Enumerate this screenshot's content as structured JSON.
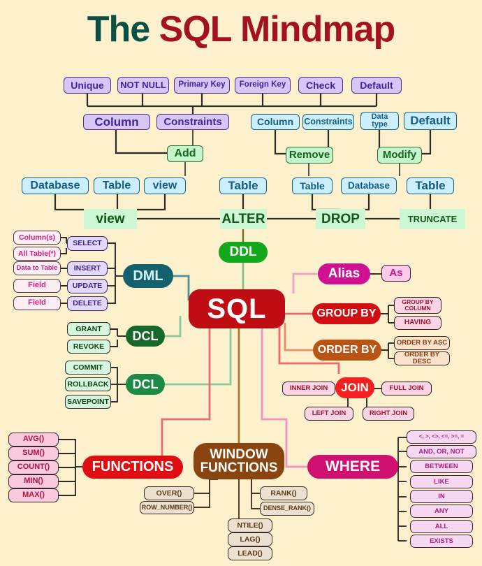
{
  "title": {
    "part1": "The ",
    "part2": "SQL Mindmap"
  },
  "background_color": "#fdf0cd",
  "center": {
    "label": "SQL",
    "color": "#c00d13"
  },
  "branches": {
    "ddl": {
      "label": "DDL",
      "color": "#12a81b",
      "operations": [
        {
          "label": "view",
          "color": "#c7f5cb",
          "targets": [
            "Database",
            "Table",
            "view"
          ]
        },
        {
          "label": "ALTER",
          "color": "#c7f5cb",
          "targets": [
            "Table"
          ]
        },
        {
          "label": "DROP",
          "color": "#c7f5cb",
          "targets": [
            "Table",
            "Database"
          ]
        },
        {
          "label": "TRUNCATE",
          "color": "#cdf7d2",
          "targets": [
            "Table"
          ]
        }
      ],
      "alter_actions": [
        {
          "label": "Add",
          "items": [
            "Column",
            "Constraints"
          ],
          "item_color": "#d8c6f7"
        },
        {
          "label": "Remove",
          "items": [
            "Column",
            "Constraints"
          ],
          "item_color": "#ccefff"
        },
        {
          "label": "Modify",
          "items": [
            "Data\ntype",
            "Default"
          ],
          "item_color": "#ccefff"
        }
      ],
      "constraints": [
        "Unique",
        "NOT NULL",
        "Primary Key",
        "Foreign Key",
        "Check",
        "Default"
      ]
    },
    "dml": {
      "label": "DML",
      "color": "#14616e",
      "statements": [
        {
          "label": "SELECT",
          "args": [
            "Column(s)",
            "All Table(*)"
          ]
        },
        {
          "label": "INSERT",
          "args": [
            "Data to Table"
          ]
        },
        {
          "label": "UPDATE",
          "args": [
            "Field"
          ]
        },
        {
          "label": "DELETE",
          "args": [
            "Field"
          ]
        }
      ]
    },
    "dcl": {
      "label": "DCL",
      "color": "#17692a",
      "items": [
        "GRANT",
        "REVOKE"
      ]
    },
    "tcl": {
      "label": "DCL",
      "color": "#1d8a45",
      "items": [
        "COMMIT",
        "ROLLBACK",
        "SAVEPOINT"
      ]
    },
    "alias": {
      "label": "Alias",
      "color": "#cf1093",
      "items": [
        "As"
      ]
    },
    "group_by": {
      "label": "GROUP BY",
      "color": "#d10f13",
      "items": [
        "GROUP BY\nCOLUMN",
        "HAVING"
      ]
    },
    "order_by": {
      "label": "ORDER BY",
      "color": "#b95414",
      "items": [
        "ORDER BY ASC",
        "ORDER BY DESC"
      ]
    },
    "join": {
      "label": "JOIN",
      "color": "#f71e20",
      "items": [
        "INNER JOIN",
        "FULL JOIN",
        "LEFT JOIN",
        "RIGHT JOIN"
      ]
    },
    "functions": {
      "label": "FUNCTIONS",
      "color": "#e00d13",
      "items": [
        "AVG()",
        "SUM()",
        "COUNT()",
        "MIN()",
        "MAX()"
      ]
    },
    "window_functions": {
      "label": "WINDOW\nFUNCTIONS",
      "color": "#8a4410",
      "items": [
        "OVER()",
        "ROW_NUMBER()",
        "RANK()",
        "DENSE_RANK()",
        "NTILE()",
        "LAG()",
        "LEAD()"
      ]
    },
    "where": {
      "label": "WHERE",
      "color": "#cf1071",
      "items": [
        "<, >, <>, <=, >=, =",
        "AND, OR, NOT",
        "BETWEEN",
        "LIKE",
        "IN",
        "ANY",
        "ALL",
        "EXISTS"
      ]
    }
  }
}
